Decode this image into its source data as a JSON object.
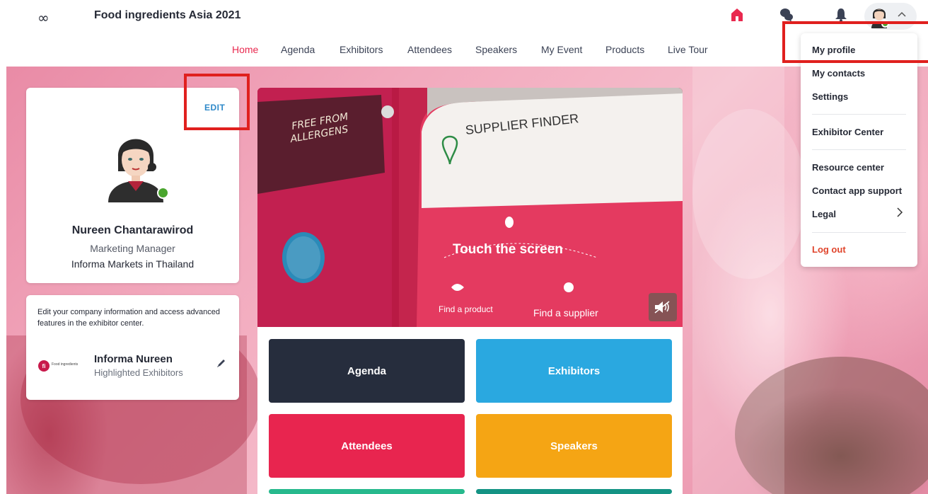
{
  "header": {
    "logo_glyph": "∞",
    "event_title": "Food ingredients Asia 2021",
    "accent": "#e9294f"
  },
  "nav": {
    "items": [
      "Home",
      "Agenda",
      "Exhibitors",
      "Attendees",
      "Speakers",
      "My Event",
      "Products",
      "Live Tour"
    ],
    "active": "Home"
  },
  "profile": {
    "edit_label": "EDIT",
    "name": "Nureen Chantarawirod",
    "job_title": "Marketing Manager",
    "company": "Informa Markets in Thailand",
    "status_color": "#4aa52e"
  },
  "exhibitor_card": {
    "description": "Edit your company information and access advanced features in the exhibitor center.",
    "company_name": "Informa Nureen",
    "subtitle": "Highlighted Exhibitors",
    "logo_text": "Food ingredients"
  },
  "video": {
    "sign_free_from": "FREE FROM",
    "sign_allergens": "ALLERGENS",
    "sign_supplier_finder": "SUPPLIER FINDER",
    "sign_touch": "Touch the screen",
    "sign_find_product": "Find a product",
    "sign_find_supplier": "Find a supplier",
    "mute_glyph": "🔇"
  },
  "tiles": [
    {
      "label": "Agenda",
      "color": "#262d3d"
    },
    {
      "label": "Exhibitors",
      "color": "#2aa8e0"
    },
    {
      "label": "Attendees",
      "color": "#e8254f"
    },
    {
      "label": "Speakers",
      "color": "#f5a514"
    },
    {
      "label": "",
      "color": "#27b98d"
    },
    {
      "label": "",
      "color": "#149384"
    }
  ],
  "dropdown": {
    "items": [
      "My profile",
      "My contacts",
      "Settings",
      "Exhibitor Center",
      "Resource center",
      "Contact app support",
      "Legal",
      "Log out"
    ],
    "legal_chevron": ">",
    "logout_color": "#e0452c",
    "chevron_up": "^"
  }
}
